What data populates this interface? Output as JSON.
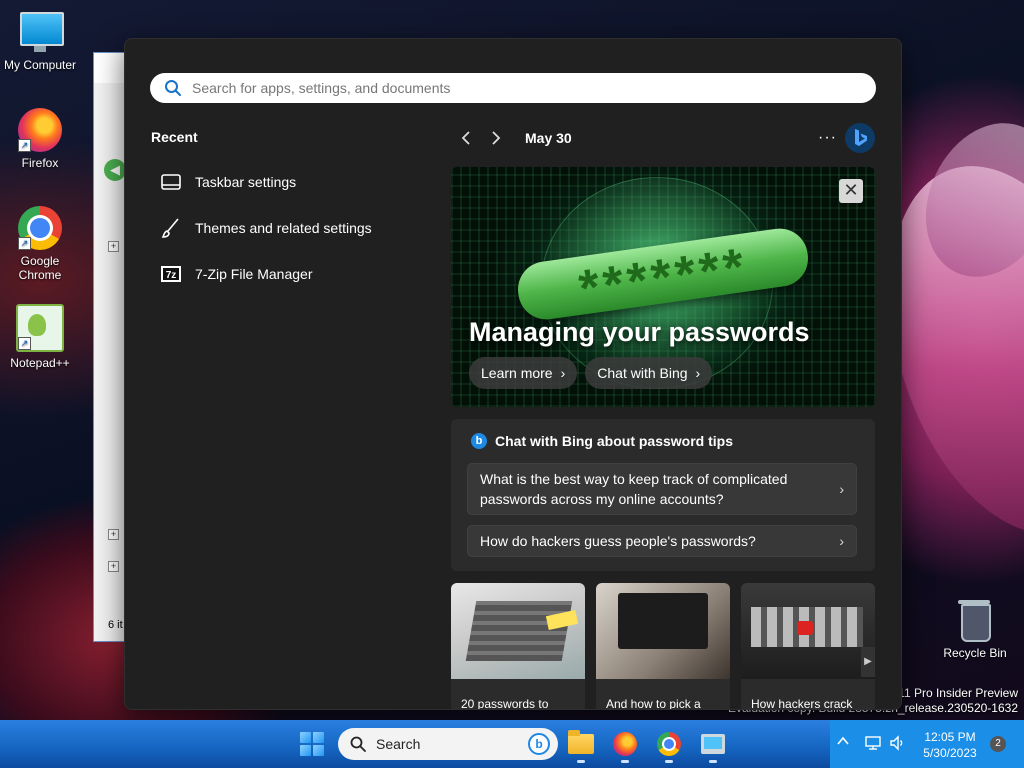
{
  "desktop": {
    "icons": [
      {
        "label": "My Computer",
        "icon": "computer-icon"
      },
      {
        "label": "Firefox",
        "icon": "firefox-icon"
      },
      {
        "label": "Google Chrome",
        "icon": "chrome-icon"
      },
      {
        "label": "Notepad++",
        "icon": "notepadpp-icon"
      },
      {
        "label": "Recycle Bin",
        "icon": "recycle-bin-icon"
      }
    ],
    "background_window": {
      "status_count": "6 it"
    },
    "watermark": {
      "line1": "s 11 Pro Insider Preview",
      "line2": "Evaluation copy. Build 23575.zn_release.230520-1632"
    }
  },
  "start_menu": {
    "search": {
      "placeholder": "Search for apps, settings, and documents",
      "value": ""
    },
    "recent": {
      "title": "Recent",
      "items": [
        {
          "label": "Taskbar settings",
          "icon": "taskbar-icon"
        },
        {
          "label": "Themes and related settings",
          "icon": "brush-icon"
        },
        {
          "label": "7-Zip File Manager",
          "icon": "7zip-icon"
        }
      ]
    },
    "widgets": {
      "date": "May 30",
      "more_label": "···",
      "hero": {
        "password_mask": "*******",
        "headline": "Managing your passwords",
        "learn_more": "Learn more",
        "chat_bing": "Chat with Bing",
        "close_glyph": "✕"
      },
      "chat_card": {
        "title": "Chat with Bing about password tips",
        "questions": [
          "What is the best way to keep track of complicated passwords across my online accounts?",
          "How do hackers guess people's passwords?"
        ]
      },
      "articles": [
        {
          "caption": "20 passwords to"
        },
        {
          "caption": "And how to pick a"
        },
        {
          "caption": "How hackers crack"
        }
      ]
    }
  },
  "taskbar": {
    "search_label": "Search",
    "apps": [
      "file-explorer-icon",
      "firefox-icon",
      "chrome-icon",
      "remote-desktop-icon"
    ],
    "tray": {
      "time": "12:05 PM",
      "date": "5/30/2023",
      "notification_count": "2"
    }
  },
  "colors": {
    "start_bg": "#202020",
    "card_bg": "#2b2b2b",
    "taskbar_blue": "#1565c0",
    "accent": "#1e88e5"
  }
}
